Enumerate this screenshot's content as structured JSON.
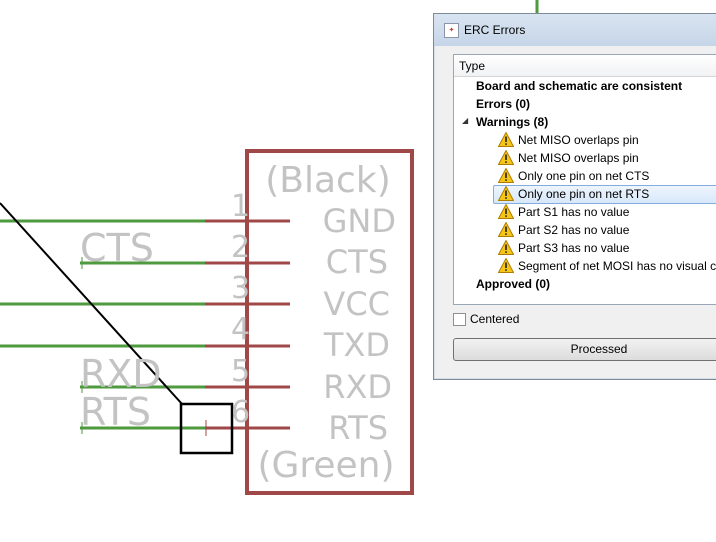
{
  "schematic": {
    "part_name": "(Black)",
    "part_value": "(Green)",
    "pins": [
      {
        "number": "1",
        "name": "GND"
      },
      {
        "number": "2",
        "name": "CTS"
      },
      {
        "number": "3",
        "name": "VCC"
      },
      {
        "number": "4",
        "name": "TXD"
      },
      {
        "number": "5",
        "name": "RXD"
      },
      {
        "number": "6",
        "name": "RTS"
      }
    ],
    "net_labels": [
      "CTS",
      "RXD",
      "RTS"
    ],
    "colors": {
      "net": "#4e9a3e",
      "pin": "#a04848",
      "frame": "#a04848",
      "text": "#c3c3c3",
      "wire": "#000000"
    }
  },
  "erc": {
    "window_title": "ERC Errors",
    "app_icon": "eagle-app-icon",
    "column_header": "Type",
    "rows": [
      {
        "text": "Board and schematic are consistent"
      },
      {
        "text": "Errors (0)"
      },
      {
        "text": "Warnings (8)"
      },
      {
        "text": "Net MISO overlaps pin"
      },
      {
        "text": "Net MISO overlaps pin"
      },
      {
        "text": "Only one pin on net CTS"
      },
      {
        "text": "Only one pin on net RTS"
      },
      {
        "text": "Part S1 has no value"
      },
      {
        "text": "Part S2 has no value"
      },
      {
        "text": "Part S3 has no value"
      },
      {
        "text": "Segment of net MOSI has no visual co"
      },
      {
        "text": "Approved (0)"
      }
    ],
    "selected_row": "Only one pin on net RTS",
    "centered_label": "Centered",
    "centered_checked": false,
    "processed_label": "Processed",
    "warning_icon": "warning-triangle-icon"
  }
}
